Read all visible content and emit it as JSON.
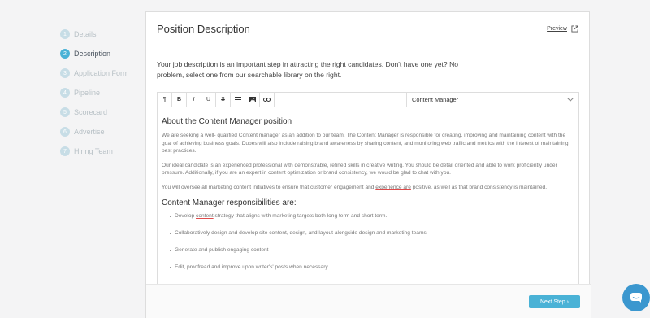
{
  "steps": [
    {
      "num": "1",
      "label": "Details"
    },
    {
      "num": "2",
      "label": "Description"
    },
    {
      "num": "3",
      "label": "Application Form"
    },
    {
      "num": "4",
      "label": "Pipeline"
    },
    {
      "num": "5",
      "label": "Scorecard"
    },
    {
      "num": "6",
      "label": "Advertise"
    },
    {
      "num": "7",
      "label": "Hiring Team"
    }
  ],
  "card": {
    "title": "Position Description",
    "preview": "Preview",
    "intro": "Your job description is an important step in attracting the right candidates. Don't have one yet? No problem, select one from our searchable library on the right."
  },
  "toolbar": {
    "paragraph": "¶",
    "bold": "B",
    "italic": "I",
    "underline": "U",
    "strike": "S",
    "template_select": "Content Manager"
  },
  "content": {
    "h2": "About the Content Manager position",
    "p1a": "We are seeking a well- qualified Content manager as an addition to our team. The Content Manager is responsible for creating, improving and maintaining content with the goal of achieving business goals.  Dubes will also include raising brand awareness by sharing ",
    "p1u": "content",
    "p1b": ", and monitoring web traffic and metrics with the interest of maintaining best practices.",
    "p2a": "Our ideal candidate is an experienced professional with demonstrable, refined skills in creative writing. You should be ",
    "p2u": "detail oriented",
    "p2b": " and able to work proficiently under pressure.  Additionally, if you are an expert in content optimization or brand consistency, we would be glad to chat with you.",
    "p3a": "You will oversee all marketing content initiatives to ensure that customer engagement and ",
    "p3u": "experience  are",
    "p3b": " positive, as well as that brand consistency is maintained.",
    "h3": "Content Manager responsibilities are:",
    "li1a": "Develop ",
    "li1u": "content",
    "li1b": " strategy that aligns with marketing targets both long term and short term.",
    "li2": "Collaboratively design and develop site content, design, and layout alongside design and marketing teams.",
    "li3": "Generate and publish engaging content",
    "li4": "Edit, proofread and improve upon  writer's' posts when necessary"
  },
  "footer": {
    "next": "Next Step ›"
  }
}
